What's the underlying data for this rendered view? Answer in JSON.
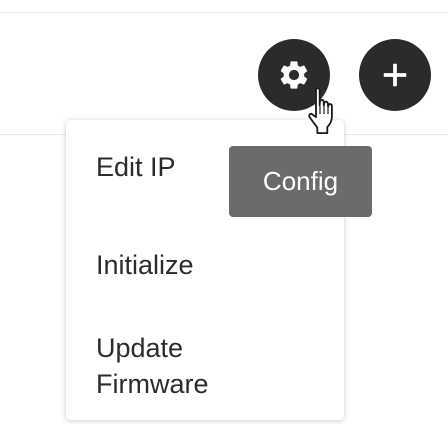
{
  "toolbar": {
    "settings_button": {
      "icon": "gear-icon",
      "color": "#2b2b2b"
    },
    "add_button": {
      "icon": "plus-icon",
      "color": "#2b2b2b"
    }
  },
  "tooltip": {
    "label": "Config",
    "background": "#6b6b6b"
  },
  "menu": {
    "items": [
      {
        "label": "Edit IP"
      },
      {
        "label": "Initialize"
      },
      {
        "label": "Update Firmware"
      }
    ]
  },
  "cursor": {
    "icon": "hand-pointer-icon"
  }
}
